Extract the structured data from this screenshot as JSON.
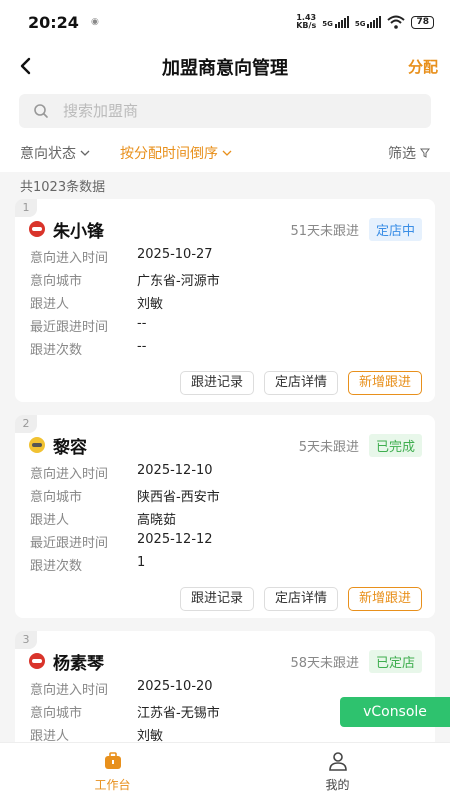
{
  "status": {
    "time": "20:24",
    "net_speed": "1.43\nKB/s",
    "battery": "78"
  },
  "header": {
    "title": "加盟商意向管理",
    "assign_label": "分配"
  },
  "search": {
    "placeholder": "搜索加盟商"
  },
  "filters": {
    "status_label": "意向状态",
    "sort_label": "按分配时间倒序",
    "screen_label": "筛选"
  },
  "summary": {
    "count_text": "共1023条数据"
  },
  "field_labels": {
    "entry_time": "意向进入时间",
    "city": "意向城市",
    "follower": "跟进人",
    "last_follow": "最近跟进时间",
    "follow_count": "跟进次数"
  },
  "actions": {
    "records": "跟进记录",
    "detail": "定店详情",
    "add": "新增跟进"
  },
  "cards": [
    {
      "index": "1",
      "name": "朱小锋",
      "days": "51天未跟进",
      "status": "定店中",
      "status_color": "#3a8ee6",
      "entry_time": "2025-10-27",
      "city": "广东省-河源市",
      "follower": "刘敏",
      "last_follow": "--",
      "follow_count": "--"
    },
    {
      "index": "2",
      "name": "黎容",
      "days": "5天未跟进",
      "status": "已完成",
      "status_color": "#3fae4f",
      "entry_time": "2025-12-10",
      "city": "陕西省-西安市",
      "follower": "高晓茹",
      "last_follow": "2025-12-12",
      "follow_count": "1"
    },
    {
      "index": "3",
      "name": "杨素琴",
      "days": "58天未跟进",
      "status": "已定店",
      "status_color": "#3fae4f",
      "entry_time": "2025-10-20",
      "city": "江苏省-无锡市",
      "follower": "刘敏"
    }
  ],
  "vconsole": {
    "label": "vConsole"
  },
  "tabbar": {
    "workbench": "工作台",
    "mine": "我的"
  },
  "colors": {
    "accent": "#e8901c",
    "vconsole": "#2ec26e"
  }
}
